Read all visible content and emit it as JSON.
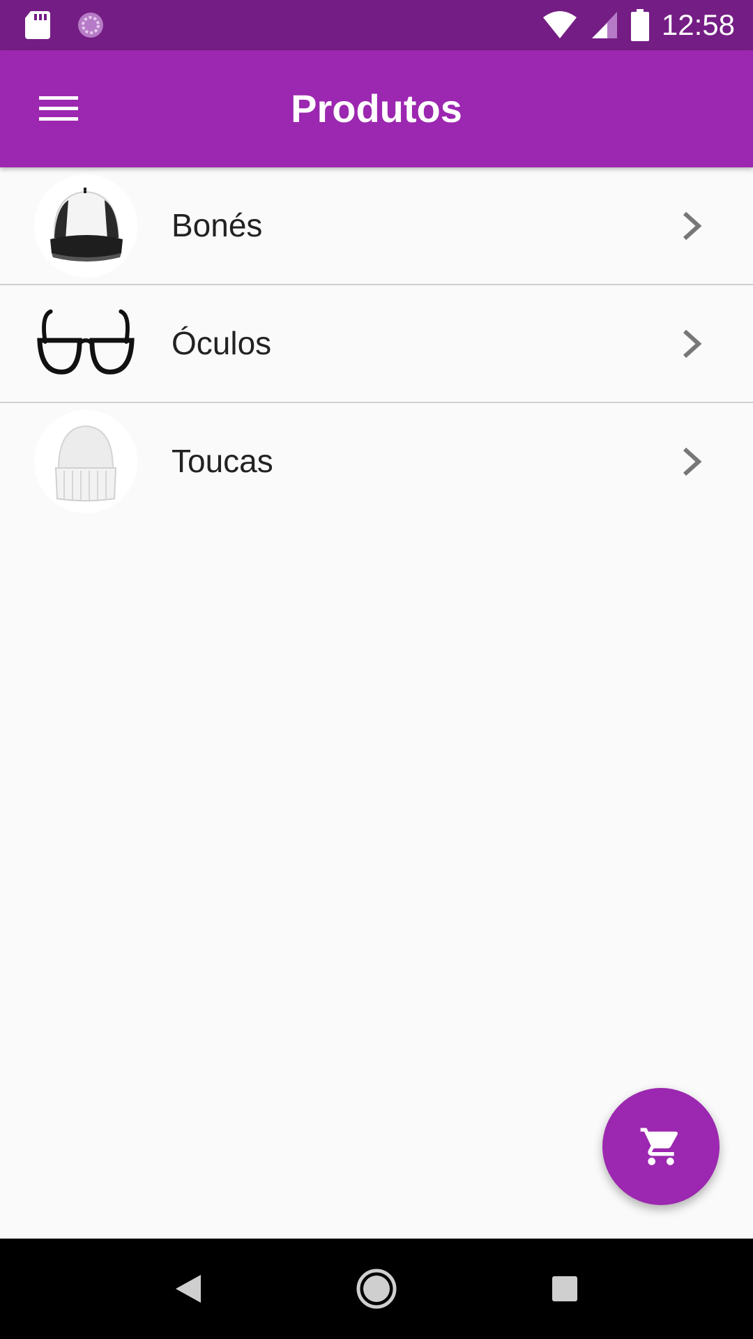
{
  "status_bar": {
    "time": "12:58",
    "icons": [
      "sd-card-icon",
      "sync-icon",
      "wifi-icon",
      "cell-signal-icon",
      "battery-icon"
    ]
  },
  "app_bar": {
    "title": "Produtos",
    "menu_icon": "menu-icon",
    "background": "#9c27b0"
  },
  "categories": [
    {
      "label": "Bonés",
      "image": "cap-image"
    },
    {
      "label": "Óculos",
      "image": "glasses-image"
    },
    {
      "label": "Toucas",
      "image": "beanie-image"
    }
  ],
  "fab": {
    "icon": "shopping-cart-icon",
    "color": "#9c27b0"
  },
  "nav_bar": {
    "icons": [
      "back-icon",
      "home-icon",
      "recents-icon"
    ]
  }
}
